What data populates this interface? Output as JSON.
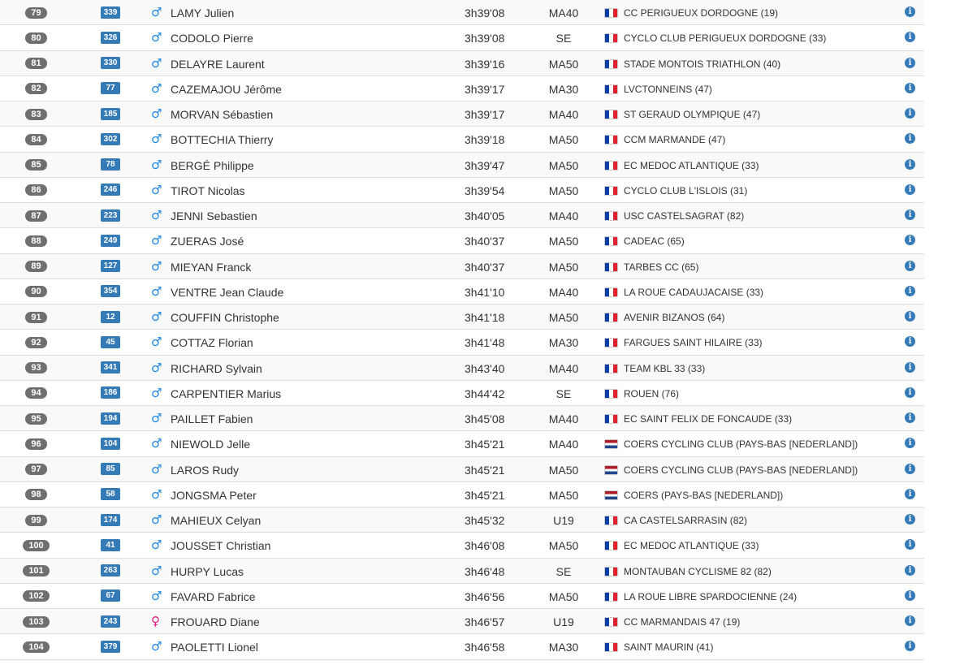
{
  "info_glyph": "i",
  "rows": [
    {
      "rank": "79",
      "bib": "339",
      "sex": "male",
      "sex_glyph": "♂",
      "name": "LAMY Julien",
      "time": "3h39'08",
      "category": "MA40",
      "flag": "fr",
      "club": "CC PERIGUEUX DORDOGNE (19)"
    },
    {
      "rank": "80",
      "bib": "326",
      "sex": "male",
      "sex_glyph": "♂",
      "name": "CODOLO Pierre",
      "time": "3h39'08",
      "category": "SE",
      "flag": "fr",
      "club": "CYCLO CLUB PERIGUEUX DORDOGNE (33)"
    },
    {
      "rank": "81",
      "bib": "330",
      "sex": "male",
      "sex_glyph": "♂",
      "name": "DELAYRE Laurent",
      "time": "3h39'16",
      "category": "MA50",
      "flag": "fr",
      "club": "STADE MONTOIS TRIATHLON (40)"
    },
    {
      "rank": "82",
      "bib": "77",
      "sex": "male",
      "sex_glyph": "♂",
      "name": "CAZEMAJOU Jérôme",
      "time": "3h39'17",
      "category": "MA30",
      "flag": "fr",
      "club": "LVCTONNEINS (47)"
    },
    {
      "rank": "83",
      "bib": "185",
      "sex": "male",
      "sex_glyph": "♂",
      "name": "MORVAN Sébastien",
      "time": "3h39'17",
      "category": "MA40",
      "flag": "fr",
      "club": "ST GERAUD OLYMPIQUE (47)"
    },
    {
      "rank": "84",
      "bib": "302",
      "sex": "male",
      "sex_glyph": "♂",
      "name": "BOTTECHIA Thierry",
      "time": "3h39'18",
      "category": "MA50",
      "flag": "fr",
      "club": "CCM MARMANDE (47)"
    },
    {
      "rank": "85",
      "bib": "78",
      "sex": "male",
      "sex_glyph": "♂",
      "name": "BERGÉ Philippe",
      "time": "3h39'47",
      "category": "MA50",
      "flag": "fr",
      "club": "EC MEDOC ATLANTIQUE (33)"
    },
    {
      "rank": "86",
      "bib": "246",
      "sex": "male",
      "sex_glyph": "♂",
      "name": "TIROT Nicolas",
      "time": "3h39'54",
      "category": "MA50",
      "flag": "fr",
      "club": "CYCLO CLUB L'ISLOIS (31)"
    },
    {
      "rank": "87",
      "bib": "223",
      "sex": "male",
      "sex_glyph": "♂",
      "name": "JENNI Sebastien",
      "time": "3h40'05",
      "category": "MA40",
      "flag": "fr",
      "club": "USC CASTELSAGRAT (82)"
    },
    {
      "rank": "88",
      "bib": "249",
      "sex": "male",
      "sex_glyph": "♂",
      "name": "ZUERAS José",
      "time": "3h40'37",
      "category": "MA50",
      "flag": "fr",
      "club": "CADEAC (65)"
    },
    {
      "rank": "89",
      "bib": "127",
      "sex": "male",
      "sex_glyph": "♂",
      "name": "MIEYAN Franck",
      "time": "3h40'37",
      "category": "MA50",
      "flag": "fr",
      "club": "TARBES CC (65)"
    },
    {
      "rank": "90",
      "bib": "354",
      "sex": "male",
      "sex_glyph": "♂",
      "name": "VENTRE Jean Claude",
      "time": "3h41'10",
      "category": "MA40",
      "flag": "fr",
      "club": "LA ROUE CADAUJACAISE (33)"
    },
    {
      "rank": "91",
      "bib": "12",
      "sex": "male",
      "sex_glyph": "♂",
      "name": "COUFFIN Christophe",
      "time": "3h41'18",
      "category": "MA50",
      "flag": "fr",
      "club": "AVENIR BIZANOS (64)"
    },
    {
      "rank": "92",
      "bib": "45",
      "sex": "male",
      "sex_glyph": "♂",
      "name": "COTTAZ Florian",
      "time": "3h41'48",
      "category": "MA30",
      "flag": "fr",
      "club": "FARGUES SAINT HILAIRE (33)"
    },
    {
      "rank": "93",
      "bib": "341",
      "sex": "male",
      "sex_glyph": "♂",
      "name": "RICHARD Sylvain",
      "time": "3h43'40",
      "category": "MA40",
      "flag": "fr",
      "club": "TEAM KBL 33 (33)"
    },
    {
      "rank": "94",
      "bib": "186",
      "sex": "male",
      "sex_glyph": "♂",
      "name": "CARPENTIER Marius",
      "time": "3h44'42",
      "category": "SE",
      "flag": "fr",
      "club": "ROUEN (76)"
    },
    {
      "rank": "95",
      "bib": "194",
      "sex": "male",
      "sex_glyph": "♂",
      "name": "PAILLET Fabien",
      "time": "3h45'08",
      "category": "MA40",
      "flag": "fr",
      "club": "EC SAINT FELIX DE FONCAUDE (33)"
    },
    {
      "rank": "96",
      "bib": "104",
      "sex": "male",
      "sex_glyph": "♂",
      "name": "NIEWOLD Jelle",
      "time": "3h45'21",
      "category": "MA40",
      "flag": "nl",
      "club": "COERS CYCLING CLUB (PAYS-BAS [NEDERLAND])"
    },
    {
      "rank": "97",
      "bib": "85",
      "sex": "male",
      "sex_glyph": "♂",
      "name": "LAROS Rudy",
      "time": "3h45'21",
      "category": "MA50",
      "flag": "nl",
      "club": "COERS CYCLING CLUB (PAYS-BAS [NEDERLAND])"
    },
    {
      "rank": "98",
      "bib": "58",
      "sex": "male",
      "sex_glyph": "♂",
      "name": "JONGSMA Peter",
      "time": "3h45'21",
      "category": "MA50",
      "flag": "nl",
      "club": "COERS (PAYS-BAS [NEDERLAND])"
    },
    {
      "rank": "99",
      "bib": "174",
      "sex": "male",
      "sex_glyph": "♂",
      "name": "MAHIEUX Celyan",
      "time": "3h45'32",
      "category": "U19",
      "flag": "fr",
      "club": "CA CASTELSARRASIN (82)"
    },
    {
      "rank": "100",
      "bib": "41",
      "sex": "male",
      "sex_glyph": "♂",
      "name": "JOUSSET Christian",
      "time": "3h46'08",
      "category": "MA50",
      "flag": "fr",
      "club": "EC MEDOC ATLANTIQUE (33)"
    },
    {
      "rank": "101",
      "bib": "263",
      "sex": "male",
      "sex_glyph": "♂",
      "name": "HURPY Lucas",
      "time": "3h46'48",
      "category": "SE",
      "flag": "fr",
      "club": "MONTAUBAN CYCLISME 82 (82)"
    },
    {
      "rank": "102",
      "bib": "67",
      "sex": "male",
      "sex_glyph": "♂",
      "name": "FAVARD Fabrice",
      "time": "3h46'56",
      "category": "MA50",
      "flag": "fr",
      "club": "LA ROUE LIBRE SPARDOCIENNE (24)"
    },
    {
      "rank": "103",
      "bib": "243",
      "sex": "female",
      "sex_glyph": "♀",
      "name": "FROUARD Diane",
      "time": "3h46'57",
      "category": "U19",
      "flag": "fr",
      "club": "CC MARMANDAIS 47 (19)"
    },
    {
      "rank": "104",
      "bib": "379",
      "sex": "male",
      "sex_glyph": "♂",
      "name": "PAOLETTI Lionel",
      "time": "3h46'58",
      "category": "MA30",
      "flag": "fr",
      "club": "SAINT MAURIN (41)"
    }
  ],
  "colors": {
    "rank_badge": "#6f6f6f",
    "bib_badge": "#337ab7",
    "male_icon": "#1e88e5",
    "female_icon": "#e91e8c",
    "info_icon": "#337ab7",
    "row_stripe": "#f9f9f9",
    "row_border": "#dedede"
  }
}
